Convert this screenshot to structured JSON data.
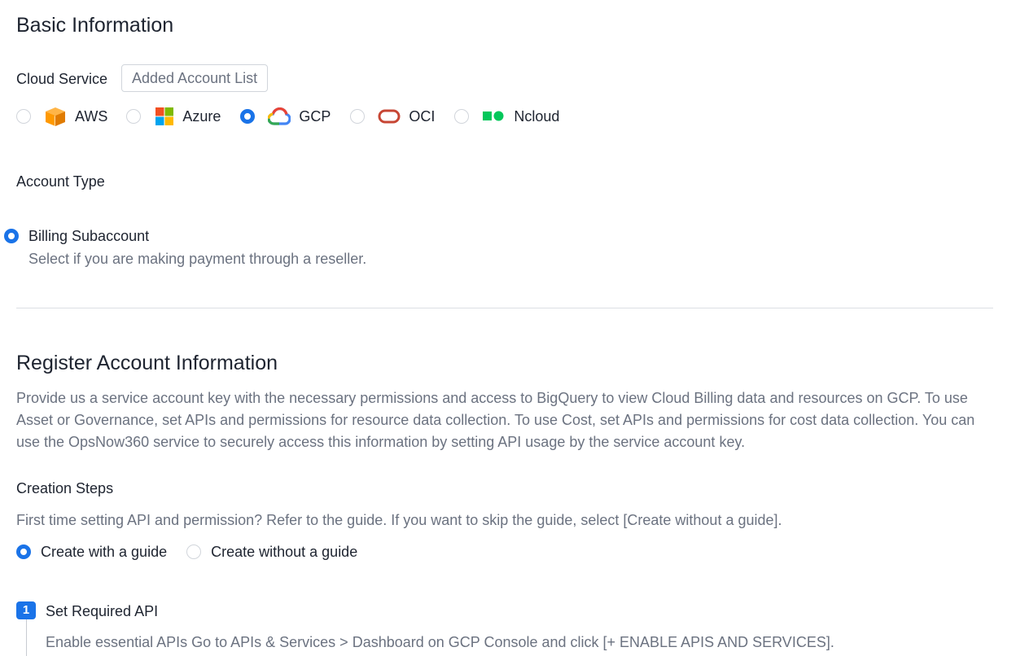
{
  "basic": {
    "title": "Basic Information",
    "cloud_service_label": "Cloud Service",
    "added_account_list_button": "Added Account List",
    "providers": [
      {
        "label": "AWS",
        "checked": false
      },
      {
        "label": "Azure",
        "checked": false
      },
      {
        "label": "GCP",
        "checked": true
      },
      {
        "label": "OCI",
        "checked": false
      },
      {
        "label": "Ncloud",
        "checked": false
      }
    ],
    "account_type_label": "Account Type",
    "account_type_option": "Billing Subaccount",
    "account_type_desc": "Select if you are making payment through a reseller."
  },
  "register": {
    "title": "Register Account Information",
    "description": "Provide us a service account key with the necessary permissions and access to BigQuery to view Cloud Billing data and resources on GCP. To use Asset or Governance, set APIs and permissions for resource data collection. To use Cost, set APIs and permissions for cost data collection. You can use the OpsNow360 service to securely access this information by setting API usage by the service account key.",
    "creation_steps_label": "Creation Steps",
    "creation_steps_desc": "First time setting API and permission? Refer to the guide. If you want to skip the guide, select [Create without a guide].",
    "options": [
      {
        "label": "Create with a guide",
        "checked": true
      },
      {
        "label": "Create without a guide",
        "checked": false
      }
    ],
    "step1": {
      "number": "1",
      "title": "Set Required API",
      "desc": "Enable essential APIs Go to APIs & Services > Dashboard on GCP Console and click [+ ENABLE APIS AND SERVICES]."
    }
  },
  "colors": {
    "accent": "#1a73e8",
    "aws": "#f90",
    "oci": "#c74634",
    "ncloud": "#03c75a"
  }
}
